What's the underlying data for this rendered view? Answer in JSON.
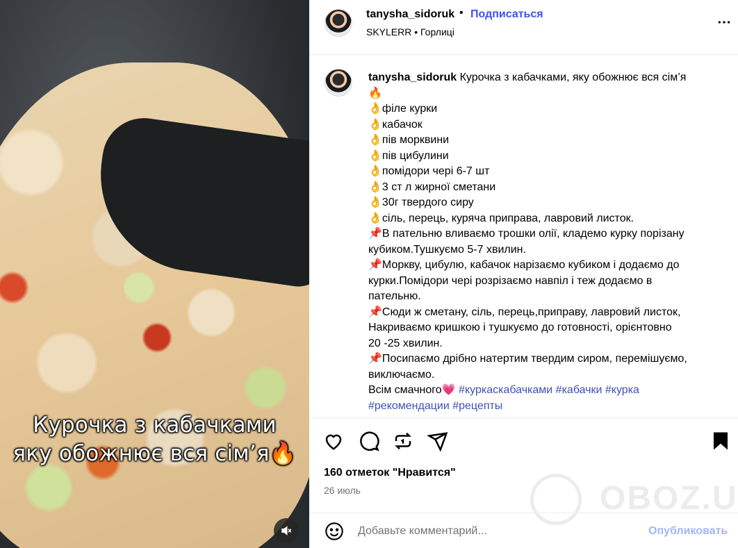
{
  "media": {
    "overlay_line1": "Курочка з кабачками",
    "overlay_line2": "яку обожнює вся сім’я🔥",
    "mute_icon": "speaker-muted-icon"
  },
  "header": {
    "username": "tanysha_sidoruk",
    "dot": "•",
    "follow_label": "Подписаться",
    "subtitle": "SKYLERR • Горлиці",
    "more_icon": "more-horizontal-icon"
  },
  "caption": {
    "username": "tanysha_sidoruk",
    "text": " Курочка з кабачками, яку обожнює вся сім’я\n🔥\n👌філе курки\n👌кабачок\n👌пів морквини\n👌пів цибулини\n👌помідори чері 6-7 шт\n👌3 ст л жирної сметани\n👌30г твердого сиру\n👌сіль, перець, куряча приправа, лавровий листок.\n📌В пательню вливаємо трошки олії, кладемо курку порізану\nкубиком.Тушкуємо 5-7 хвилин.\n📌Моркву, цибулю, кабачок нарізаємо кубиком і додаємо до\nкурки.Помідори чері розрізаємо навпіл і теж додаємо в\nпательню.\n📌Сюди ж сметану, сіль, перець,приправу, лавровий листок,\nНакриваємо кришкою і тушкуємо до готовності, орієнтовно\n20 -25 хвилин.\n📌Посипаємо дрібно натертим твердим сиром, перемішуємо,\nвиключаємо.\nВсім смачного💗",
    "hashtags": [
      "#куркаскабачками",
      "#кабачки",
      "#курка",
      "#рекомендации",
      "#рецепты"
    ]
  },
  "actions": {
    "icons": [
      "heart-icon",
      "comment-icon",
      "repost-icon",
      "share-icon",
      "bookmark-icon"
    ]
  },
  "likes": "160 отметок \"Нравится\"",
  "date": "26 июль",
  "watermark": "OBOZ.UA",
  "comment": {
    "placeholder": "Добавьте комментарий...",
    "publish_label": "Опубликовать"
  },
  "colors": {
    "link": "#4150f7",
    "hashtag": "#3f51b5",
    "publish_disabled": "#a3b5f5",
    "muted_text": "#737373"
  }
}
